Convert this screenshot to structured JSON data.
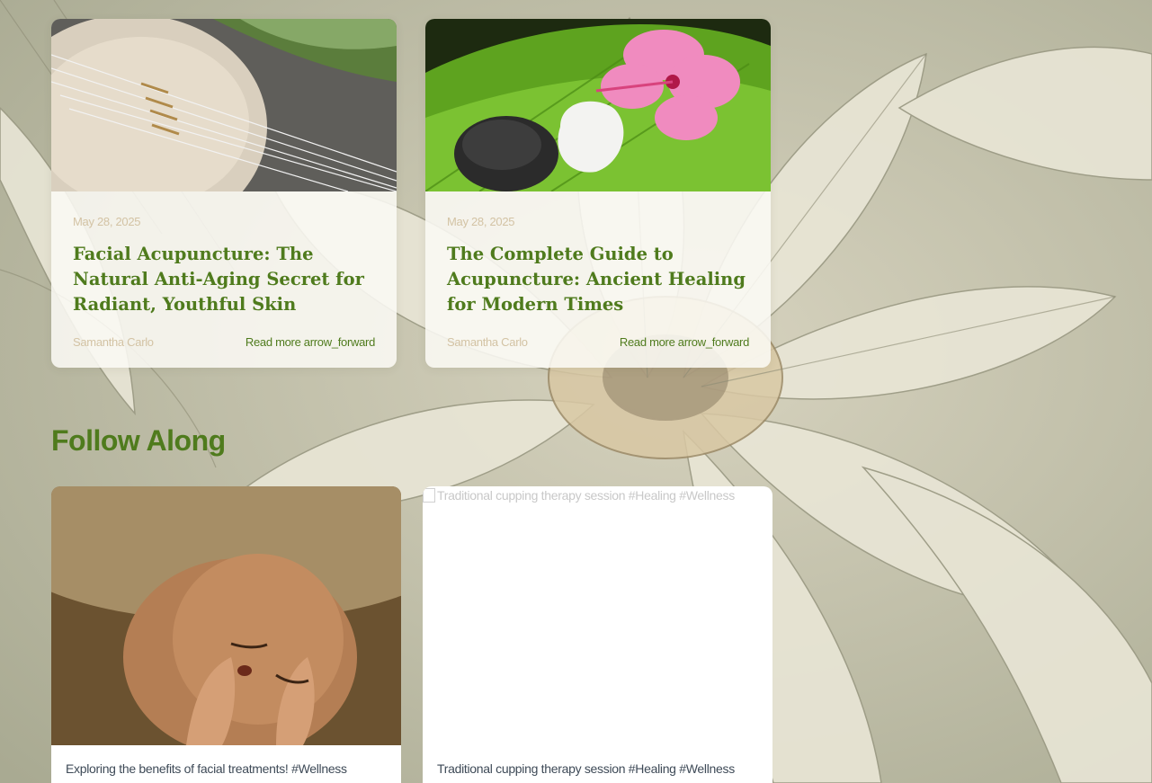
{
  "blog": [
    {
      "date": "May 28, 2025",
      "title": "Facial Acupuncture: The Natural Anti-Aging Secret for Radiant, Youthful Skin",
      "author": "Samantha Carlo",
      "read_more": "Read more arrow_forward"
    },
    {
      "date": "May 28, 2025",
      "title": "The Complete Guide to Acupuncture: Ancient Healing for Modern Times",
      "author": "Samantha Carlo",
      "read_more": "Read more arrow_forward"
    }
  ],
  "follow": {
    "title": "Follow Along",
    "posts": [
      {
        "caption": "Exploring the benefits of facial treatments! #Wellness"
      },
      {
        "alt_text": "Traditional cupping therapy session #Healing #Wellness",
        "caption": "Traditional cupping therapy session #Healing #Wellness"
      }
    ]
  },
  "colors": {
    "accent_green": "#4f7b1d",
    "muted_tan": "#d3c3a4",
    "caption_text": "#3e4a57"
  }
}
